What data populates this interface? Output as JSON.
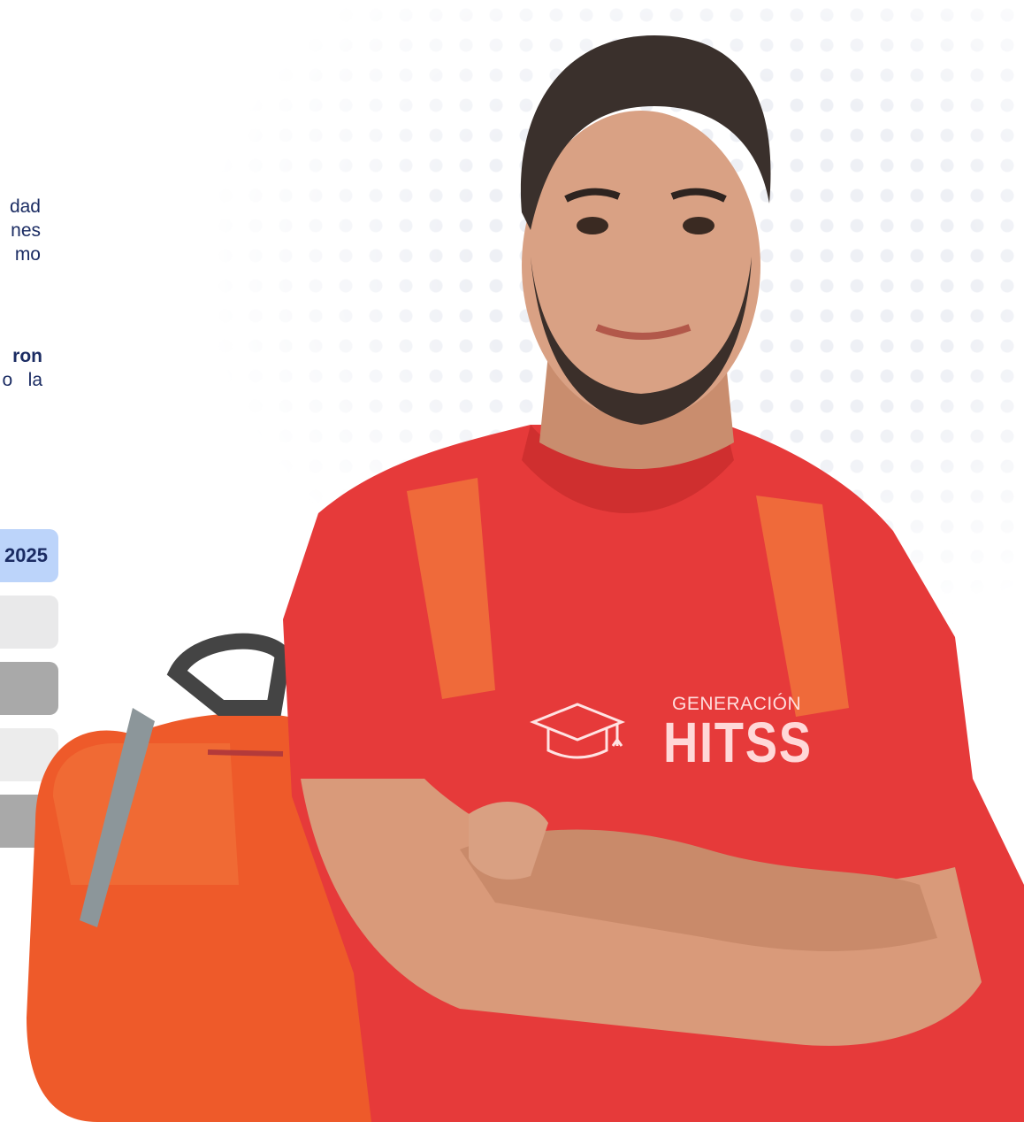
{
  "text_block_1": {
    "lines": [
      "dad",
      "nes",
      "mo"
    ]
  },
  "text_block_2": {
    "line1_bold": "ron",
    "line2": "o   la"
  },
  "year_tabs": {
    "active_label": "2025"
  },
  "shirt_logo": {
    "subtitle": "GENERACIÓN",
    "title": "HITSS",
    "icon": "graduation-cap-icon"
  },
  "colors": {
    "text_navy": "#1b2c63",
    "active_tab": "#bcd4fa",
    "shirt_red": "#e63a3a",
    "backpack_orange": "#ee5a2a"
  }
}
